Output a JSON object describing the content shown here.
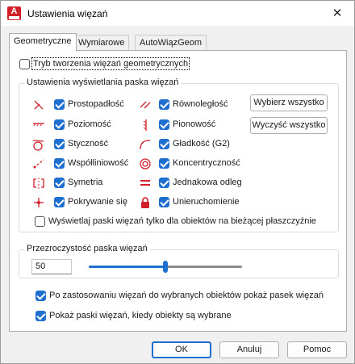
{
  "window": {
    "title": "Ustawienia więzań",
    "close_glyph": "✕",
    "icon": "autocad-app-icon",
    "icon_letter": "A"
  },
  "tabs": [
    {
      "label": "Geometryczne",
      "active": true
    },
    {
      "label": "Wymiarowe",
      "active": false
    },
    {
      "label": "AutoWiązGeom",
      "active": false
    }
  ],
  "infer_mode": {
    "label": "Tryb tworzenia więzań geometrycznych",
    "checked": false
  },
  "display_group": {
    "title": "Ustawienia wyświetlania paska więzań",
    "left_items": [
      {
        "label": "Prostopadłość",
        "checked": true,
        "icon": "perpendicular-icon"
      },
      {
        "label": "Poziomość",
        "checked": true,
        "icon": "horizontal-icon"
      },
      {
        "label": "Styczność",
        "checked": true,
        "icon": "tangent-icon"
      },
      {
        "label": "Współliniowość",
        "checked": true,
        "icon": "collinear-icon"
      },
      {
        "label": "Symetria",
        "checked": true,
        "icon": "symmetric-icon"
      },
      {
        "label": "Pokrywanie się",
        "checked": true,
        "icon": "coincident-icon"
      }
    ],
    "right_items": [
      {
        "label": "Równoległość",
        "checked": true,
        "icon": "parallel-icon"
      },
      {
        "label": "Pionowość",
        "checked": true,
        "icon": "vertical-icon"
      },
      {
        "label": "Gładkość (G2)",
        "checked": true,
        "icon": "smooth-icon"
      },
      {
        "label": "Koncentryczność",
        "checked": true,
        "icon": "concentric-icon"
      },
      {
        "label": "Jednakowa odleg",
        "checked": true,
        "icon": "equal-icon"
      },
      {
        "label": "Unieruchomienie",
        "checked": true,
        "icon": "fix-lock-icon"
      }
    ],
    "select_all_label": "Wybierz wszystko",
    "clear_all_label": "Wyczyść wszystko",
    "current_plane": {
      "label": "Wyświetlaj paski więzań tylko dla obiektów na bieżącej płaszczyźnie",
      "checked": false
    }
  },
  "transparency_group": {
    "title": "Przezroczystość paska więzań",
    "value": "50",
    "slider_fraction": 0.5
  },
  "show_after_apply": {
    "label": "Po zastosowaniu więzań do wybranych obiektów pokaż pasek więzań",
    "checked": true
  },
  "show_when_selected": {
    "label": "Pokaż paski więzań, kiedy obiekty są wybrane",
    "checked": true
  },
  "buttons": {
    "ok": "OK",
    "cancel": "Anuluj",
    "help": "Pomoc"
  },
  "colors": {
    "accent": "#1f6fd1",
    "constraint_icon": "#d2202a"
  }
}
